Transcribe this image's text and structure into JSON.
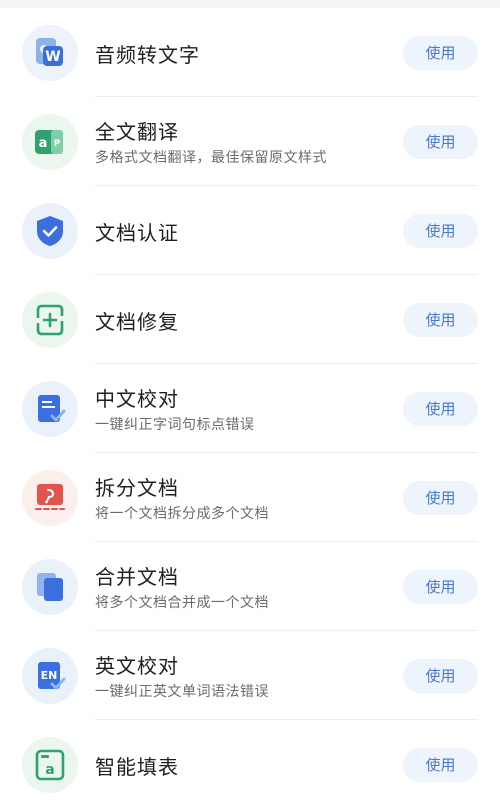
{
  "colors": {
    "accent": "#4a79c8",
    "button_bg": "#eef4fb",
    "title": "#1f1f1f",
    "subtitle": "#6b6b70"
  },
  "tools": [
    {
      "title": "音频转文字",
      "subtitle": "",
      "button": "使用",
      "icon": "audio-to-text-icon"
    },
    {
      "title": "全文翻译",
      "subtitle": "多格式文档翻译，最佳保留原文样式",
      "button": "使用",
      "icon": "translate-icon"
    },
    {
      "title": "文档认证",
      "subtitle": "",
      "button": "使用",
      "icon": "shield-check-icon"
    },
    {
      "title": "文档修复",
      "subtitle": "",
      "button": "使用",
      "icon": "document-repair-icon"
    },
    {
      "title": "中文校对",
      "subtitle": "一键纠正字词句标点错误",
      "button": "使用",
      "icon": "chinese-proofread-icon"
    },
    {
      "title": "拆分文档",
      "subtitle": "将一个文档拆分成多个文档",
      "button": "使用",
      "icon": "split-document-icon"
    },
    {
      "title": "合并文档",
      "subtitle": "将多个文档合并成一个文档",
      "button": "使用",
      "icon": "merge-documents-icon"
    },
    {
      "title": "英文校对",
      "subtitle": "一键纠正英文单词语法错误",
      "button": "使用",
      "icon": "english-proofread-icon"
    },
    {
      "title": "智能填表",
      "subtitle": "",
      "button": "使用",
      "icon": "smart-form-icon"
    }
  ]
}
